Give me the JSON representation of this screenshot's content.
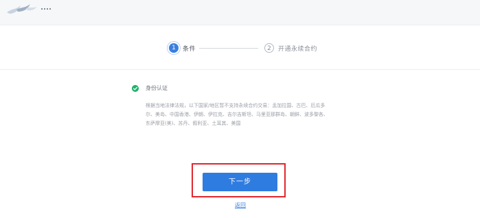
{
  "header": {
    "logo_icon": "brand-logo-icon"
  },
  "steps": [
    {
      "number": "1",
      "label": "条件",
      "state": "active"
    },
    {
      "number": "2",
      "label": "开通永续合约",
      "state": "inactive"
    }
  ],
  "section": {
    "status_icon": "check-circle-icon",
    "title": "身份认证",
    "description": "根据当地法律法规，以下国家/地区暂不支持永续合约交易：孟加拉国、古巴、厄瓜多尔、美岛、中国香港、伊朗、伊拉克、吉尔吉斯坦、马里亚那群岛、朝鲜、波多黎各、东萨摩亚(美)、苏丹、叙利亚、土耳其、美国"
  },
  "actions": {
    "next_label": "下一步",
    "back_label": "返回"
  },
  "colors": {
    "accent": "#2f7ce1",
    "success": "#21b26d",
    "highlight": "#e0262b"
  }
}
